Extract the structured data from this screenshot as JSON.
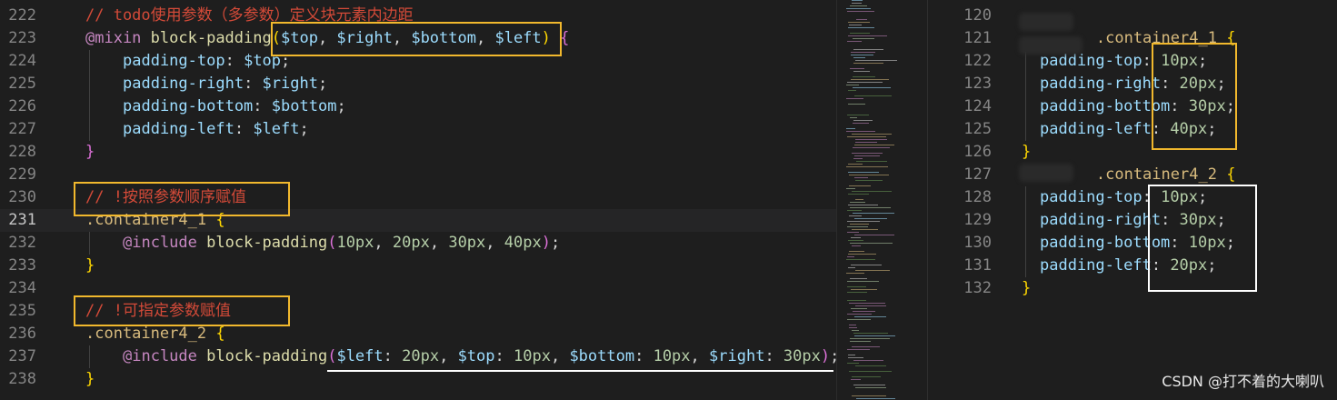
{
  "left_pane": {
    "lines": [
      {
        "num": "222",
        "tokens": [
          [
            "// todo使用参数（多参数）定义块元素内边距",
            "c-com-red"
          ]
        ],
        "indent": 0
      },
      {
        "num": "223",
        "tokens": [
          [
            "@mixin",
            "c-kw"
          ],
          [
            " ",
            "c-pun"
          ],
          [
            "block-padding",
            "c-fn"
          ],
          [
            "(",
            "c-br1"
          ],
          [
            "$top",
            "c-var"
          ],
          [
            ", ",
            "c-pun"
          ],
          [
            "$right",
            "c-var"
          ],
          [
            ", ",
            "c-pun"
          ],
          [
            "$bottom",
            "c-var"
          ],
          [
            ", ",
            "c-pun"
          ],
          [
            "$left",
            "c-var"
          ],
          [
            ")",
            "c-br1"
          ],
          [
            " ",
            "c-pun"
          ],
          [
            "{",
            "c-br2"
          ]
        ],
        "indent": 0
      },
      {
        "num": "224",
        "tokens": [
          [
            "padding-top",
            "c-prop"
          ],
          [
            ": ",
            "c-pun"
          ],
          [
            "$top",
            "c-var"
          ],
          [
            ";",
            "c-pun"
          ]
        ],
        "indent": 1
      },
      {
        "num": "225",
        "tokens": [
          [
            "padding-right",
            "c-prop"
          ],
          [
            ": ",
            "c-pun"
          ],
          [
            "$right",
            "c-var"
          ],
          [
            ";",
            "c-pun"
          ]
        ],
        "indent": 1
      },
      {
        "num": "226",
        "tokens": [
          [
            "padding-bottom",
            "c-prop"
          ],
          [
            ": ",
            "c-pun"
          ],
          [
            "$bottom",
            "c-var"
          ],
          [
            ";",
            "c-pun"
          ]
        ],
        "indent": 1
      },
      {
        "num": "227",
        "tokens": [
          [
            "padding-left",
            "c-prop"
          ],
          [
            ": ",
            "c-pun"
          ],
          [
            "$left",
            "c-var"
          ],
          [
            ";",
            "c-pun"
          ]
        ],
        "indent": 1
      },
      {
        "num": "228",
        "tokens": [
          [
            "}",
            "c-br2"
          ]
        ],
        "indent": 0
      },
      {
        "num": "229",
        "tokens": [],
        "indent": 0
      },
      {
        "num": "230",
        "tokens": [
          [
            "// !按照参数顺序赋值",
            "c-com-red"
          ]
        ],
        "indent": 0
      },
      {
        "num": "231",
        "tokens": [
          [
            ".container4_1",
            "c-sel"
          ],
          [
            " ",
            "c-pun"
          ],
          [
            "{",
            "c-br1"
          ]
        ],
        "indent": 0,
        "current": true
      },
      {
        "num": "232",
        "tokens": [
          [
            "@include",
            "c-kw"
          ],
          [
            " ",
            "c-pun"
          ],
          [
            "block-padding",
            "c-fn"
          ],
          [
            "(",
            "c-br2"
          ],
          [
            "10px",
            "c-num"
          ],
          [
            ", ",
            "c-pun"
          ],
          [
            "20px",
            "c-num"
          ],
          [
            ", ",
            "c-pun"
          ],
          [
            "30px",
            "c-num"
          ],
          [
            ", ",
            "c-pun"
          ],
          [
            "40px",
            "c-num"
          ],
          [
            ")",
            "c-br2"
          ],
          [
            ";",
            "c-pun"
          ]
        ],
        "indent": 1
      },
      {
        "num": "233",
        "tokens": [
          [
            "}",
            "c-br1"
          ]
        ],
        "indent": 0
      },
      {
        "num": "234",
        "tokens": [],
        "indent": 0
      },
      {
        "num": "235",
        "tokens": [
          [
            "// !可指定参数赋值",
            "c-com-red"
          ]
        ],
        "indent": 0
      },
      {
        "num": "236",
        "tokens": [
          [
            ".container4_2",
            "c-sel"
          ],
          [
            " ",
            "c-pun"
          ],
          [
            "{",
            "c-br1"
          ]
        ],
        "indent": 0
      },
      {
        "num": "237",
        "tokens": [
          [
            "@include",
            "c-kw"
          ],
          [
            " ",
            "c-pun"
          ],
          [
            "block-padding",
            "c-fn"
          ],
          [
            "(",
            "c-br2"
          ],
          [
            "$left",
            "c-var"
          ],
          [
            ": ",
            "c-pun"
          ],
          [
            "20px",
            "c-num"
          ],
          [
            ", ",
            "c-pun"
          ],
          [
            "$top",
            "c-var"
          ],
          [
            ": ",
            "c-pun"
          ],
          [
            "10px",
            "c-num"
          ],
          [
            ", ",
            "c-pun"
          ],
          [
            "$bottom",
            "c-var"
          ],
          [
            ": ",
            "c-pun"
          ],
          [
            "10px",
            "c-num"
          ],
          [
            ", ",
            "c-pun"
          ],
          [
            "$right",
            "c-var"
          ],
          [
            ": ",
            "c-pun"
          ],
          [
            "30px",
            "c-num"
          ],
          [
            ")",
            "c-br2"
          ],
          [
            ";",
            "c-pun"
          ]
        ],
        "indent": 1
      },
      {
        "num": "238",
        "tokens": [
          [
            "}",
            "c-br1"
          ]
        ],
        "indent": 0
      }
    ]
  },
  "right_pane": {
    "lines": [
      {
        "num": "120",
        "tokens": [],
        "indent": 0
      },
      {
        "num": "121",
        "tokens": [
          [
            "        .container4_1",
            "c-sel"
          ],
          [
            " ",
            "c-pun"
          ],
          [
            "{",
            "c-br1"
          ]
        ],
        "indent": 0
      },
      {
        "num": "122",
        "tokens": [
          [
            "padding-top",
            "c-prop"
          ],
          [
            ": ",
            "c-pun"
          ],
          [
            "10px",
            "c-num"
          ],
          [
            ";",
            "c-pun"
          ]
        ],
        "indent": 1
      },
      {
        "num": "123",
        "tokens": [
          [
            "padding-right",
            "c-prop"
          ],
          [
            ": ",
            "c-pun"
          ],
          [
            "20px",
            "c-num"
          ],
          [
            ";",
            "c-pun"
          ]
        ],
        "indent": 1
      },
      {
        "num": "124",
        "tokens": [
          [
            "padding-bottom",
            "c-prop"
          ],
          [
            ": ",
            "c-pun"
          ],
          [
            "30px",
            "c-num"
          ],
          [
            ";",
            "c-pun"
          ]
        ],
        "indent": 1
      },
      {
        "num": "125",
        "tokens": [
          [
            "padding-left",
            "c-prop"
          ],
          [
            ": ",
            "c-pun"
          ],
          [
            "40px",
            "c-num"
          ],
          [
            ";",
            "c-pun"
          ]
        ],
        "indent": 1
      },
      {
        "num": "126",
        "tokens": [
          [
            "}",
            "c-br1"
          ]
        ],
        "indent": 0
      },
      {
        "num": "127",
        "tokens": [
          [
            "        .container4_2",
            "c-sel"
          ],
          [
            " ",
            "c-pun"
          ],
          [
            "{",
            "c-br1"
          ]
        ],
        "indent": 0
      },
      {
        "num": "128",
        "tokens": [
          [
            "padding-top",
            "c-prop"
          ],
          [
            ": ",
            "c-pun"
          ],
          [
            "10px",
            "c-num"
          ],
          [
            ";",
            "c-pun"
          ]
        ],
        "indent": 1
      },
      {
        "num": "129",
        "tokens": [
          [
            "padding-right",
            "c-prop"
          ],
          [
            ": ",
            "c-pun"
          ],
          [
            "30px",
            "c-num"
          ],
          [
            ";",
            "c-pun"
          ]
        ],
        "indent": 1
      },
      {
        "num": "130",
        "tokens": [
          [
            "padding-bottom",
            "c-prop"
          ],
          [
            ": ",
            "c-pun"
          ],
          [
            "10px",
            "c-num"
          ],
          [
            ";",
            "c-pun"
          ]
        ],
        "indent": 1
      },
      {
        "num": "131",
        "tokens": [
          [
            "padding-left",
            "c-prop"
          ],
          [
            ": ",
            "c-pun"
          ],
          [
            "20px",
            "c-num"
          ],
          [
            ";",
            "c-pun"
          ]
        ],
        "indent": 1
      },
      {
        "num": "132",
        "tokens": [
          [
            "}",
            "c-br1"
          ]
        ],
        "indent": 0
      }
    ]
  },
  "watermark": "CSDN @打不着的大喇叭",
  "colors": {
    "annotation_box": "#f1b82d",
    "annotation_box_alt": "#ffffff",
    "editor_background": "#1e1e1e"
  }
}
